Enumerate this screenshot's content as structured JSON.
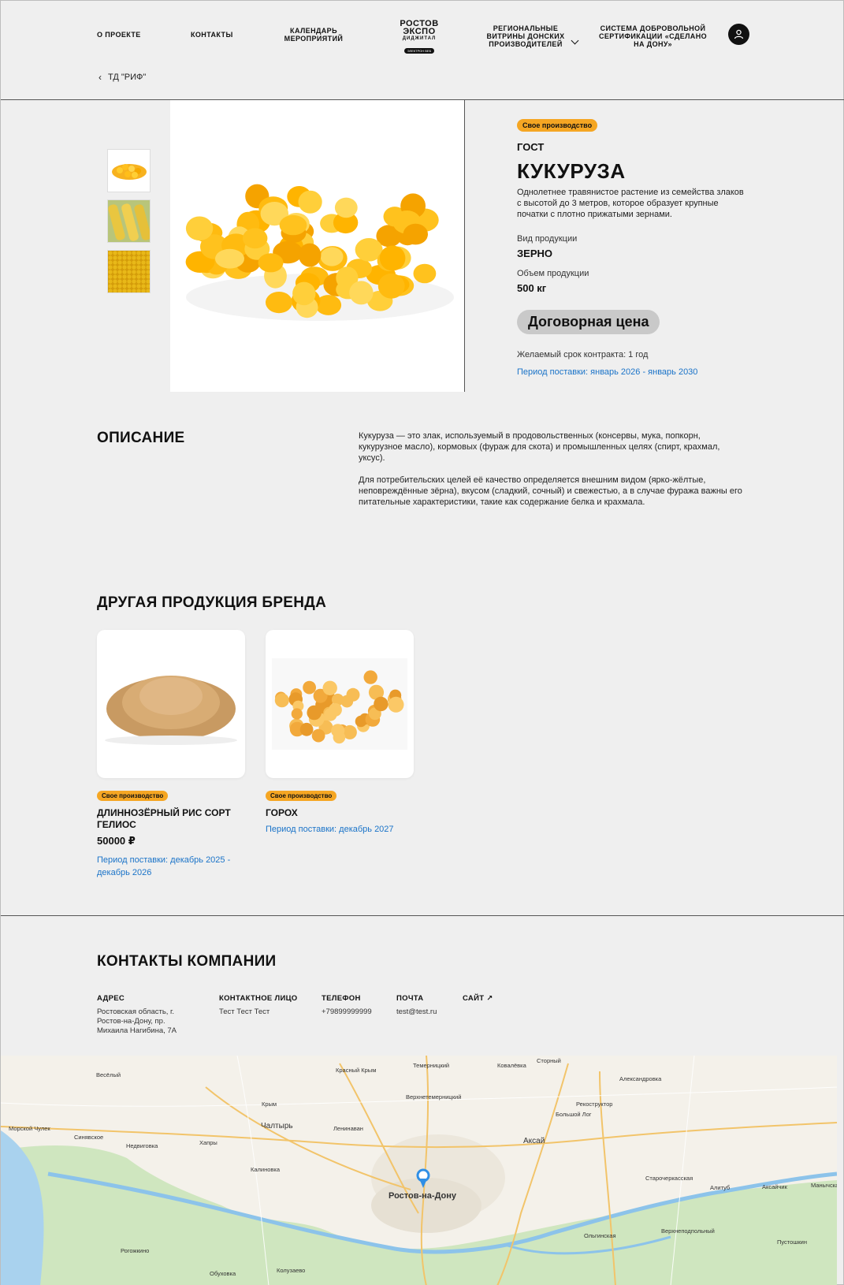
{
  "nav": {
    "items": [
      "О ПРОЕКТЕ",
      "КОНТАКТЫ",
      "КАЛЕНДАРЬ МЕРОПРИЯТИЙ",
      "РЕГИОНАЛЬНЫЕ ВИТРИНЫ ДОНСКИХ ПРОИЗВОДИТЕЛЕЙ",
      "СИСТЕМА ДОБРОВОЛЬНОЙ СЕРТИФИКАЦИИ «СДЕЛАНО НА ДОНУ»"
    ],
    "logo": {
      "line1": "РОСТОВ",
      "line2": "ЭКСПО",
      "line3": "ДИДЖИТАЛ",
      "pill": "ЭЛЕКТРОН ВЕБ"
    }
  },
  "breadcrumb": "ТД \"РИФ\"",
  "product": {
    "badge": "Свое производство",
    "gost": "ГОСТ",
    "title": "КУКУРУЗА",
    "description": "Однолетнее травянистое растение из семейства злаков с высотой до 3 метров, которое образует крупные початки с плотно прижатыми зернами.",
    "type_label": "Вид продукции",
    "type_value": "ЗЕРНО",
    "volume_label": "Объем продукции",
    "volume_value": "500 кг",
    "price": "Договорная цена",
    "term": "Желаемый срок контракта: 1 год",
    "period": "Период поставки: январь 2026 - январь 2030"
  },
  "description_section": {
    "title": "ОПИСАНИЕ",
    "p1": "Кукуруза — это злак, используемый в продовольственных (консервы, мука, попкорн, кукурузное масло), кормовых (фураж для скота) и промышленных целях (спирт, крахмал, уксус).",
    "p2": "Для потребительских целей её качество определяется внешним видом (ярко-жёлтые, неповреждённые зёрна), вкусом (сладкий, сочный) и свежестью, а в случае фуража важны его питательные характеристики, такие как содержание белка и крахмала."
  },
  "other_products": {
    "title": "ДРУГАЯ ПРОДУКЦИЯ БРЕНДА",
    "items": [
      {
        "badge": "Свое производство",
        "name": "ДЛИННОЗЁРНЫЙ РИС СОРТ ГЕЛИОС",
        "price": "50000 ₽",
        "period": "Период поставки: декабрь 2025 - декабрь 2026"
      },
      {
        "badge": "Свое производство",
        "name": "ГОРОХ",
        "price": "",
        "period": "Период поставки: декабрь 2027"
      }
    ]
  },
  "contacts": {
    "title": "КОНТАКТЫ КОМПАНИИ",
    "address_label": "АДРЕС",
    "address_value": "Ростовская область, г. Ростов-на-Дону, пр. Михаила Нагибина, 7А",
    "person_label": "КОНТАКТНОЕ ЛИЦО",
    "person_value": "Тест Тест Тест",
    "phone_label": "ТЕЛЕФОН",
    "phone_value": "+79899999999",
    "email_label": "ПОЧТА",
    "email_value": "test@test.ru",
    "site_label": "САЙТ ↗"
  },
  "map": {
    "labels": [
      "Весёлый",
      "Красный Крым",
      "Темерницкий",
      "Ковалёвка",
      "Стоpный",
      "Александровка",
      "Крым",
      "Верхнетемерницкий",
      "Рекоструктор",
      "Большой Лог",
      "Морской Чулек",
      "Синявское",
      "Недвиговка",
      "Хапры",
      "Чалтырь",
      "Ленинаван",
      "Аксай",
      "Калиновка",
      "Ростов-на-Дону",
      "Старочеркасская",
      "Алитуб",
      "Аксайчик",
      "Манычская",
      "Ольгинская",
      "Верхнеподпольный",
      "Рогожкино",
      "Обуховка",
      "Колузаево",
      "Пустошкин"
    ],
    "city": "Ростов-на-Дону"
  },
  "colors": {
    "accent_badge": "#f5a623",
    "link": "#1a73c8",
    "price_pill": "#c9c9c9"
  }
}
